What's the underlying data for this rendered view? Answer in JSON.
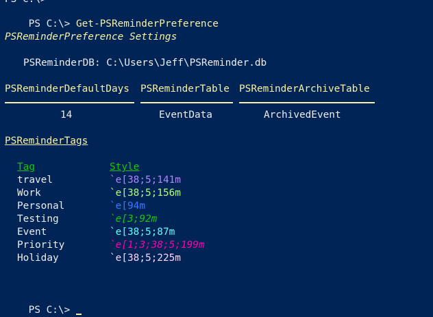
{
  "terminal": {
    "top_partial": "PS C:\\>",
    "prompt": "PS C:\\>",
    "command": "Get-PSReminderPreference",
    "section_title": "PSReminderPreference Settings",
    "db_line": "PSReminderDB: C:\\Users\\Jeff\\PSReminder.db",
    "table_headers": [
      "PSReminderDefaultDays",
      "PSReminderTable",
      "PSReminderArchiveTable"
    ],
    "table_values": [
      "14",
      "EventData",
      "ArchivedEvent"
    ],
    "tags_title": "PSReminderTags",
    "tags_columns": {
      "tag": "Tag",
      "style": "Style"
    },
    "tags": [
      {
        "tag": "travel",
        "style": "`e[38;5;141m",
        "color": "#af87ff",
        "italic": false
      },
      {
        "tag": "Work",
        "style": "`e[38;5;156m",
        "color": "#afff87",
        "italic": false
      },
      {
        "tag": "Personal",
        "style": "`e[94m",
        "color": "#3b78ff",
        "italic": false
      },
      {
        "tag": "Testing",
        "style": "`e[3;92m",
        "color": "#16c60c",
        "italic": true
      },
      {
        "tag": "Event",
        "style": "`e[38;5;87m",
        "color": "#5fffff",
        "italic": false
      },
      {
        "tag": "Priority",
        "style": "`e[1;3;38;5;199m",
        "color": "#ff00af",
        "italic": true
      },
      {
        "tag": "Holiday",
        "style": "`e[38;5;225m",
        "color": "#ffd7ff",
        "italic": false
      }
    ],
    "final_prompt": "PS C:\\> ",
    "cursor_color": "#f9f1a5"
  }
}
